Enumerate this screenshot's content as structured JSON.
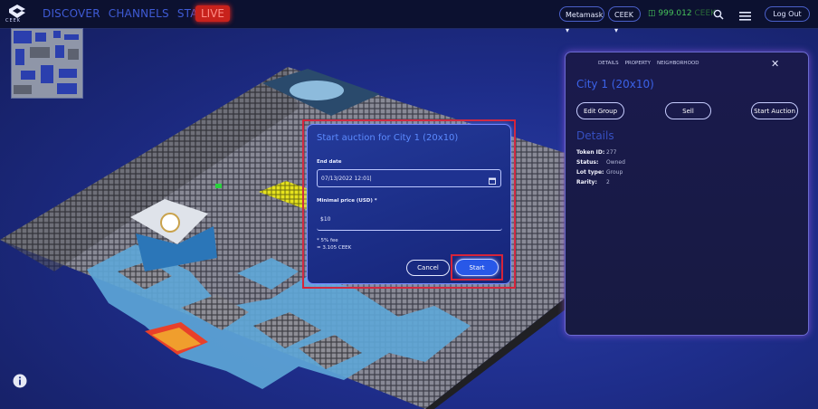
{
  "topbar": {
    "logo_text": "CEEK",
    "nav": [
      "DISCOVER",
      "CHANNELS",
      "STARS"
    ],
    "live_label": "LIVE",
    "wallet_label": "Metamask ▾",
    "currency_label": "CEEK ▾",
    "balance_value": "999.012",
    "balance_currency": "CEEK",
    "logout_label": "Log Out"
  },
  "modal": {
    "title": "Start auction for City 1 (20x10)",
    "end_date_label": "End date",
    "end_date_value": "07/13/2022 12:01",
    "min_price_label": "Minimal price (USD) *",
    "min_price_value": "$10",
    "fee_note": "* 5% fee",
    "ceek_note": "= 3.105 CEEK",
    "cancel_label": "Cancel",
    "start_label": "Start"
  },
  "panel": {
    "tabs": [
      "DETAILS",
      "PROPERTY",
      "NEIGHBORHOOD"
    ],
    "title": "City 1 (20x10)",
    "buttons": [
      "Edit Group",
      "Sell",
      "Start Auction"
    ],
    "details_heading": "Details",
    "details": [
      {
        "key": "Token ID:",
        "value": "277"
      },
      {
        "key": "Status:",
        "value": "Owned"
      },
      {
        "key": "Lot type:",
        "value": "Group"
      },
      {
        "key": "Rarity:",
        "value": "2"
      }
    ]
  },
  "colors": {
    "accent_blue": "#2858e8",
    "highlight_red": "#d6243a",
    "live_red": "#c8221c",
    "balance_green": "#46c25a"
  },
  "icons": [
    "ceek-logo-icon",
    "search-icon",
    "hamburger-menu-icon",
    "wallet-icon",
    "calendar-icon",
    "close-icon",
    "info-icon"
  ]
}
